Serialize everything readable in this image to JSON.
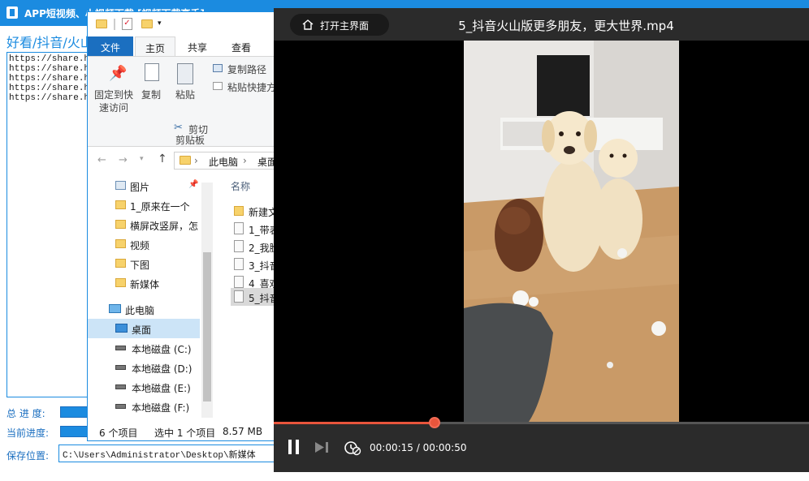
{
  "app": {
    "title": "APP短视频、小视频下载 [视频下载高手]",
    "heading": "好看/抖音/火山",
    "urls": [
      "https://share.hu",
      "https://share.hu",
      "https://share.hu",
      "https://share.hu",
      "https://share.hu"
    ],
    "total_progress_label": "总 进 度:",
    "current_progress_label": "当前进度:",
    "save_location_label": "保存位置:",
    "save_path": "C:\\Users\\Administrator\\Desktop\\新媒体"
  },
  "explorer": {
    "tabs": {
      "file": "文件",
      "home": "主页",
      "share": "共享",
      "view": "查看"
    },
    "ribbon": {
      "pin_label_1": "固定到快",
      "pin_label_2": "速访问",
      "copy_label": "复制",
      "paste_label": "粘贴",
      "copy_path_label": "复制路径",
      "paste_shortcut_label": "粘贴快捷方",
      "cut_label": "剪切",
      "clipboard_group": "剪贴板"
    },
    "address": {
      "pc": "此电脑",
      "desktop": "桌面"
    },
    "column_name": "名称",
    "nav_items": [
      {
        "label": "图片"
      },
      {
        "label": "1_原来在一个"
      },
      {
        "label": "横屏改竖屏，怎"
      },
      {
        "label": "视频"
      },
      {
        "label": "下图"
      },
      {
        "label": "新媒体"
      }
    ],
    "this_pc": "此电脑",
    "desktop": "桌面",
    "drives": [
      {
        "label": "本地磁盘 (C:)"
      },
      {
        "label": "本地磁盘 (D:)"
      },
      {
        "label": "本地磁盘 (E:)"
      },
      {
        "label": "本地磁盘 (F:)"
      }
    ],
    "files": [
      {
        "label": "新建文",
        "type": "folder"
      },
      {
        "label": "1_带表",
        "type": "mp4"
      },
      {
        "label": "2_我脸",
        "type": "mp4"
      },
      {
        "label": "3_抖音",
        "type": "mp4"
      },
      {
        "label": "4_喜欢",
        "type": "mp4"
      },
      {
        "label": "5_抖音",
        "type": "mp4"
      }
    ],
    "status": {
      "count": "6 个项目",
      "selected": "选中 1 个项目",
      "size": "8.57 MB"
    }
  },
  "player": {
    "home_button_label": "打开主界面",
    "title": "5_抖音火山版更多朋友，更大世界.mp4",
    "time": "00:00:15 / 00:00:50",
    "progress": 0.3,
    "accent_color": "#e8553c"
  }
}
